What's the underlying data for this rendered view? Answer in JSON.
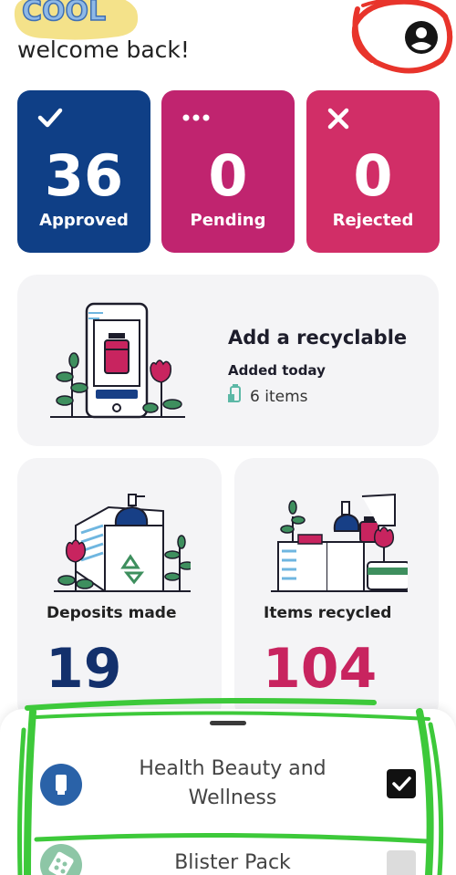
{
  "header": {
    "logo_text": "COOL",
    "welcome": "welcome back!",
    "profile_icon": "account-circle-icon"
  },
  "stats": [
    {
      "count": "36",
      "label": "Approved",
      "icon": "check-icon",
      "color": "#0f3f86"
    },
    {
      "count": "0",
      "label": "Pending",
      "icon": "ellipsis-icon",
      "color": "#c0246f"
    },
    {
      "count": "0",
      "label": "Rejected",
      "icon": "close-icon",
      "color": "#d12e67"
    }
  ],
  "add_card": {
    "title": "Add a recyclable",
    "subtitle": "Added today",
    "items": "6 items"
  },
  "deposits": {
    "label": "Deposits made",
    "value": "19",
    "color": "#13306c"
  },
  "recycled": {
    "label": "Items recycled",
    "value": "104",
    "color": "#c8245f"
  },
  "sheet": {
    "items": [
      {
        "label": "Health Beauty and Wellness",
        "icon": "lotion-tube-icon",
        "checked": true
      },
      {
        "label": "Blister Pack",
        "icon": "blister-pack-icon",
        "checked": false
      }
    ]
  },
  "annotations": {
    "red": "#e8342b",
    "green": "#3dc93a"
  }
}
